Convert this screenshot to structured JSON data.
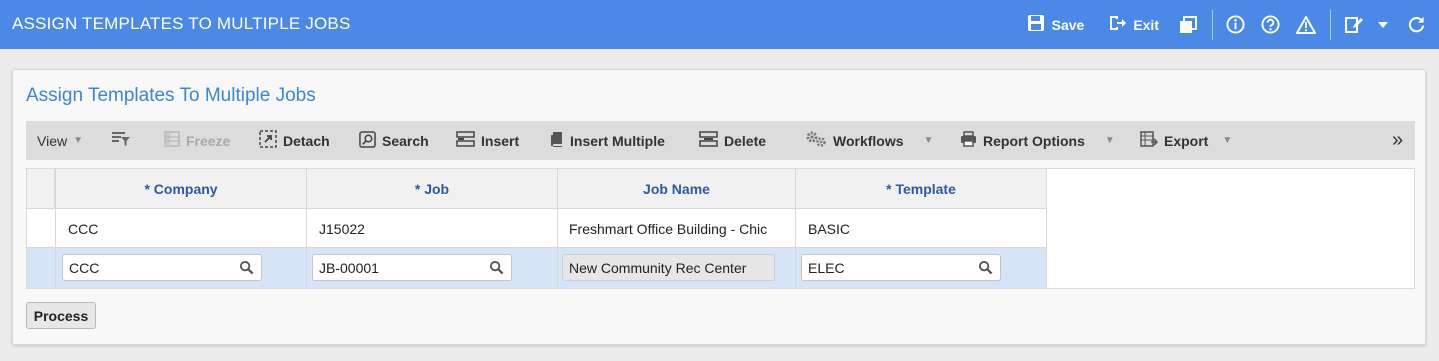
{
  "window": {
    "title": "ASSIGN TEMPLATES TO MULTIPLE JOBS",
    "save_label": "Save",
    "exit_label": "Exit",
    "accent": "#4a8ae6"
  },
  "panel": {
    "title": "Assign Templates To Multiple Jobs"
  },
  "toolbar": {
    "view_label": "View",
    "freeze_label": "Freeze",
    "detach_label": "Detach",
    "search_label": "Search",
    "insert_label": "Insert",
    "insert_multiple_label": "Insert Multiple",
    "delete_label": "Delete",
    "workflows_label": "Workflows",
    "report_options_label": "Report Options",
    "export_label": "Export",
    "more_label": "»"
  },
  "grid": {
    "columns": [
      "* Company",
      "* Job",
      "Job Name",
      "* Template"
    ],
    "row1": {
      "company": "CCC",
      "job": "J15022",
      "job_name": "Freshmart Office Building - Chic",
      "template": "BASIC"
    },
    "row2": {
      "company": "CCC",
      "job": "JB-00001",
      "job_name": "New Community Rec Center",
      "template": "ELEC"
    }
  },
  "actions": {
    "process_label": "Process"
  }
}
